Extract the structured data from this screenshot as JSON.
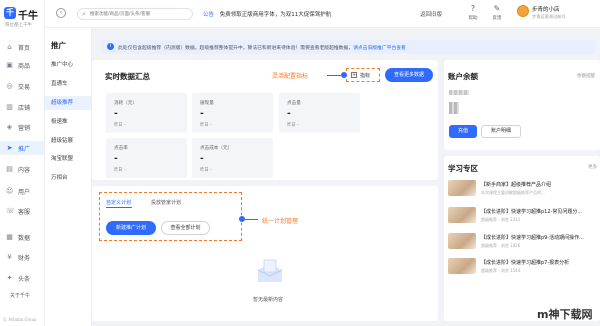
{
  "app": {
    "name": "千牛",
    "slogan": "每位都上千牛"
  },
  "left_nav": {
    "items": [
      {
        "label": "首页",
        "icon": "home-icon",
        "glyph": "⌂"
      },
      {
        "label": "商品",
        "icon": "goods-icon",
        "glyph": "▣"
      },
      {
        "label": "交易",
        "icon": "trade-icon",
        "glyph": "◎"
      },
      {
        "label": "店铺",
        "icon": "shop-icon",
        "glyph": "▥"
      },
      {
        "label": "营销",
        "icon": "marketing-icon",
        "glyph": "◈"
      },
      {
        "label": "推广",
        "icon": "promotion-icon",
        "glyph": "➤"
      },
      {
        "label": "内容",
        "icon": "content-icon",
        "glyph": "▤"
      },
      {
        "label": "用户",
        "icon": "user-icon",
        "glyph": "☺"
      },
      {
        "label": "客服",
        "icon": "service-icon",
        "glyph": "☏"
      },
      {
        "label": "数据",
        "icon": "data-icon",
        "glyph": "▦"
      },
      {
        "label": "财务",
        "icon": "finance-icon",
        "glyph": "¥"
      },
      {
        "label": "头条",
        "icon": "headline-icon",
        "glyph": "✦"
      }
    ],
    "footer_label": "关于千牛",
    "copyright": "© Alibaba Group"
  },
  "sub_nav": {
    "title": "推广",
    "items": [
      "推广中心",
      "直通车",
      "超级推荐",
      "极速推",
      "超级钻展",
      "淘宝联盟",
      "万相台"
    ]
  },
  "top_bar": {
    "search_placeholder": "搜索功能/商品/页面/头条/客服",
    "notice_tag": "公告",
    "notice_text": "免费领取正版商用字体，为双11大促保驾护航",
    "old_version": "返回旧版",
    "help": "帮助",
    "feedback": "反馈",
    "user_name": "步青的小店",
    "user_sub": "步青运营测试账号"
  },
  "banner": {
    "text": "此处仅包含超级推荐（内测版）数据，超级推荐整体提升中，算法已和新进来待体验！需要查看老版超推数据，",
    "link": "请点击旧版推广平台查看"
  },
  "realtime": {
    "title": "实时数据汇总",
    "button": "查看更多数据",
    "metric_label": "指标",
    "metrics": [
      {
        "label": "消耗（元）",
        "value": "-",
        "yesterday": "昨日 -"
      },
      {
        "label": "展现量",
        "value": "-",
        "yesterday": "昨日 -"
      },
      {
        "label": "点击量",
        "value": "-",
        "yesterday": "昨日 -"
      },
      {
        "label": "点击率",
        "value": "-",
        "yesterday": "昨日 -"
      },
      {
        "label": "点击成本（元）",
        "value": "-",
        "yesterday": "昨日 -"
      }
    ]
  },
  "annotations": {
    "config": "灵活配置指标",
    "plan": "统一计划管理"
  },
  "plans": {
    "tabs": [
      "自定义计划",
      "投放管家计划"
    ],
    "new_button": "新建推广计划",
    "all_button": "查看全部计划",
    "empty": "暂无最新内容"
  },
  "account": {
    "title": "账户余额",
    "balance_link": "余额提醒",
    "recharge": "充值",
    "detail": "账户明细"
  },
  "learning": {
    "title": "学习专区",
    "more": "更多",
    "items": [
      {
        "title": "【新手商家】超级推荐产品介绍",
        "meta": "本次课程主要讲解超级推荐产品的..."
      },
      {
        "title": "【成长进阶】快速学习超推p12-常见问题分...",
        "meta": "超级推荐 · 浏览 2311"
      },
      {
        "title": "【成长进阶】快速学习超推p9-活动期间操作...",
        "meta": "超级推荐 · 浏览 1826"
      },
      {
        "title": "【成长进阶】快速学习超推p7-报表分析",
        "meta": "超级推荐 · 浏览 1544"
      }
    ]
  },
  "watermark": "m神下载网"
}
